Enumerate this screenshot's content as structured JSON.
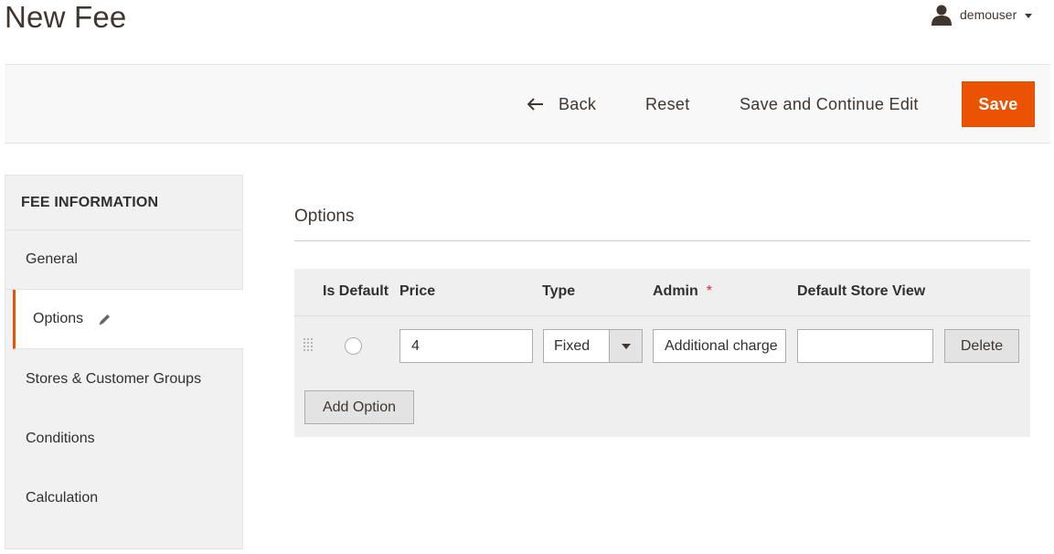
{
  "page": {
    "title": "New Fee"
  },
  "user": {
    "name": "demouser",
    "icon": "user-icon"
  },
  "actions": {
    "back_label": "Back",
    "reset_label": "Reset",
    "save_continue_label": "Save and Continue Edit",
    "save_label": "Save",
    "accent_color": "#eb5202"
  },
  "sidebar": {
    "title": "FEE INFORMATION",
    "items": [
      {
        "label": "General"
      },
      {
        "label": "Options",
        "active": true,
        "icon": "pencil-icon"
      },
      {
        "label": "Stores & Customer Groups"
      },
      {
        "label": "Conditions"
      },
      {
        "label": "Calculation"
      }
    ]
  },
  "options": {
    "section_title": "Options",
    "headers": {
      "is_default": "Is Default",
      "price": "Price",
      "type": "Type",
      "admin": "Admin",
      "admin_required": "*",
      "default_store_view": "Default Store View"
    },
    "row": {
      "price": "4",
      "type": "Fixed",
      "admin": "Additional charge",
      "default_store_view": "",
      "delete_label": "Delete"
    },
    "add_option_label": "Add Option"
  }
}
